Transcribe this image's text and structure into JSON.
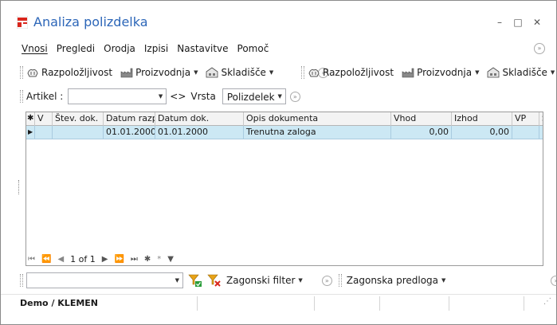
{
  "window": {
    "title": "Analiza polizdelka",
    "controls": {
      "minimize": "–",
      "maximize": "□",
      "close": "✕"
    }
  },
  "menu": {
    "items": [
      "Vnosi",
      "Pregledi",
      "Orodja",
      "Izpisi",
      "Nastavitve",
      "Pomoč"
    ]
  },
  "toolbar_left": {
    "razpolozljivost": "Razpoložljivost",
    "proizvodnja": "Proizvodnja",
    "skladisce": "Skladišče"
  },
  "toolbar_right": {
    "razpolozljivost": "Razpoložljivost",
    "proizvodnja": "Proizvodnja",
    "skladisce": "Skladišče"
  },
  "filter": {
    "artikel_label": "Artikel :",
    "artikel_value": "",
    "swap_label": "<>",
    "vrsta_label": "Vrsta",
    "vrsta_value": "Polizdelek"
  },
  "grid": {
    "columns": [
      "V",
      "Štev. dok.",
      "Datum razp.",
      "Datum dok.",
      "Opis dokumenta",
      "Vhod",
      "Izhod",
      "VP",
      "S"
    ],
    "rows": [
      {
        "v": "",
        "stev_dok": "",
        "datum_razp": "01.01.2000",
        "datum_dok": "01.01.2000",
        "opis": "Trenutna zaloga",
        "vhod": "0,00",
        "izhod": "0,00",
        "vp": "",
        "s": ""
      }
    ]
  },
  "navigator": {
    "position": "1 of 1"
  },
  "bottom": {
    "filter_value": "",
    "zagonski_filter": "Zagonski filter",
    "zagonska_predloga": "Zagonska predloga"
  },
  "status": {
    "user": "Demo / KLEMEN"
  },
  "colors": {
    "title": "#2c66b8",
    "selected_row": "#cce8f4",
    "filter_green": "#2a9d3a",
    "filter_red": "#d9261c",
    "funnel": "#e8a317"
  }
}
